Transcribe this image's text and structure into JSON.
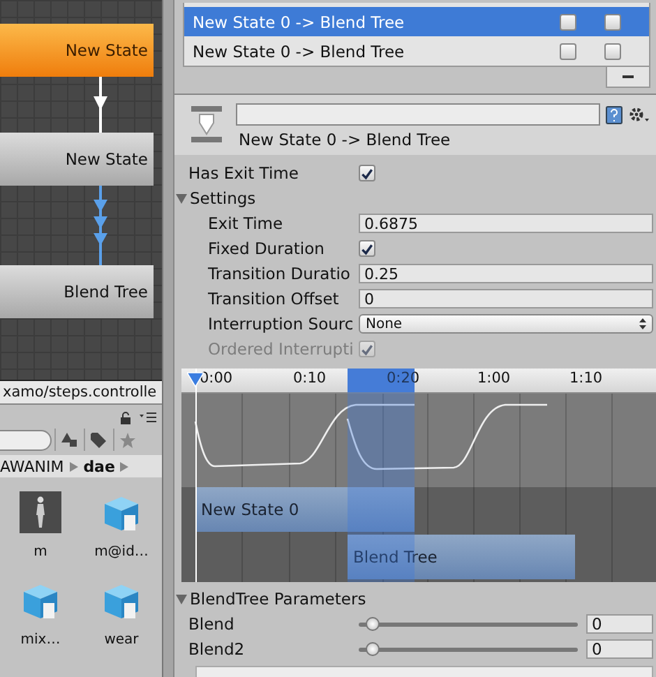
{
  "graph": {
    "nodes": [
      {
        "label": "New State",
        "kind": "default"
      },
      {
        "label": "New State",
        "kind": "normal"
      },
      {
        "label": "Blend Tree",
        "kind": "normal"
      }
    ]
  },
  "path_bar": {
    "text": "xamo/steps.controlle"
  },
  "project": {
    "breadcrumb": [
      "AWANIM",
      "dae"
    ],
    "assets": [
      {
        "name": "m",
        "kind": "model"
      },
      {
        "name": "m@id…",
        "kind": "mesh"
      },
      {
        "name": "mix…",
        "kind": "mesh"
      },
      {
        "name": "wear",
        "kind": "mesh"
      }
    ]
  },
  "transitions": [
    {
      "label": "New State 0 -> Blend Tree",
      "selected": true,
      "solo": false,
      "mute": false
    },
    {
      "label": "New State 0 -> Blend Tree",
      "selected": false,
      "solo": false,
      "mute": false
    }
  ],
  "header": {
    "title": "New State 0 -> Blend Tree"
  },
  "has_exit_time": {
    "label": "Has Exit Time",
    "checked": true
  },
  "settings": {
    "label": "Settings",
    "expanded": true,
    "fields": [
      {
        "label": "Exit Time",
        "kind": "float",
        "value": "0.6875",
        "disabled": false
      },
      {
        "label": "Fixed Duration",
        "kind": "checkbox",
        "checked": true,
        "disabled": false
      },
      {
        "label": "Transition Duratio",
        "kind": "float",
        "value": "0.25",
        "disabled": false
      },
      {
        "label": "Transition Offset",
        "kind": "float",
        "value": "0",
        "disabled": false
      },
      {
        "label": "Interruption Sourc",
        "kind": "dropdown",
        "value": "None",
        "disabled": false
      },
      {
        "label": "Ordered Interrupti",
        "kind": "checkbox",
        "checked": true,
        "disabled": true
      }
    ]
  },
  "timeline": {
    "ticks": [
      "0:00",
      "0:10",
      "0:20",
      "1:00",
      "1:10"
    ],
    "clips": [
      {
        "label": "New State 0"
      },
      {
        "label": "Blend Tree"
      }
    ]
  },
  "blend_parameters": {
    "label": "BlendTree Parameters",
    "expanded": true,
    "params": [
      {
        "name": "Blend",
        "level": 0,
        "value": "0"
      },
      {
        "name": "Blend2",
        "level": 0,
        "value": "0"
      }
    ]
  }
}
